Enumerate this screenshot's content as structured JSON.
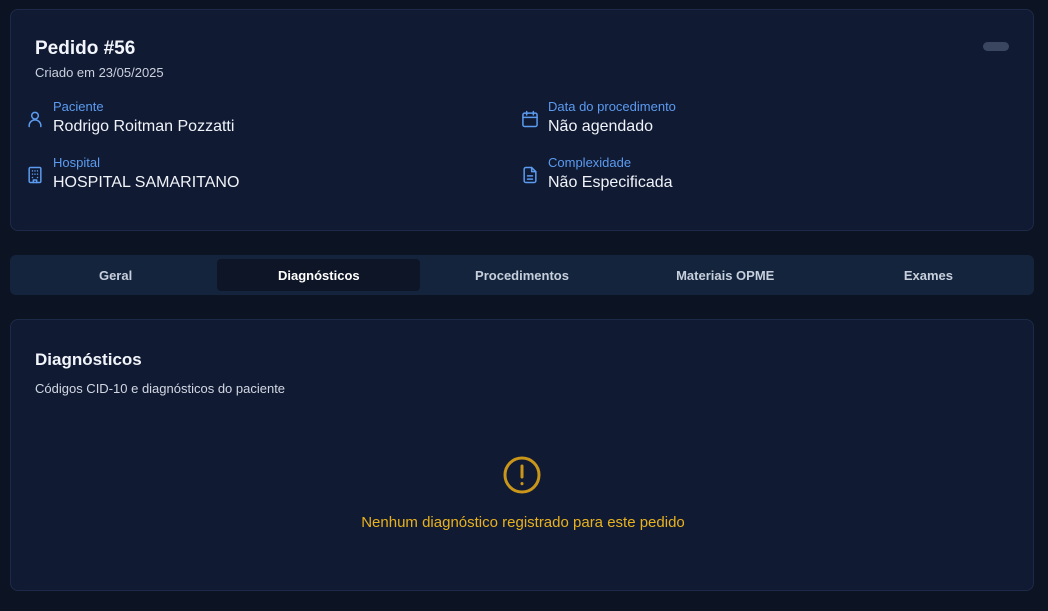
{
  "order": {
    "title": "Pedido #56",
    "created": "Criado em 23/05/2025"
  },
  "info": {
    "paciente": {
      "label": "Paciente",
      "value": "Rodrigo Roitman Pozzatti",
      "icon": "user-icon"
    },
    "data": {
      "label": "Data do procedimento",
      "value": "Não agendado",
      "icon": "calendar-icon"
    },
    "hospital": {
      "label": "Hospital",
      "value": "HOSPITAL SAMARITANO",
      "icon": "building-icon"
    },
    "complexidade": {
      "label": "Complexidade",
      "value": "Não Especificada",
      "icon": "file-text-icon"
    }
  },
  "tabs": [
    {
      "label": "Geral",
      "active": false
    },
    {
      "label": "Diagnósticos",
      "active": true
    },
    {
      "label": "Procedimentos",
      "active": false
    },
    {
      "label": "Materiais OPME",
      "active": false
    },
    {
      "label": "Exames",
      "active": false
    }
  ],
  "diagnosticos": {
    "title": "Diagnósticos",
    "subtitle": "Códigos CID-10 e diagnósticos do paciente",
    "empty_icon": "alert-circle-icon",
    "empty_message": "Nenhum diagnóstico registrado para este pedido"
  },
  "colors": {
    "background": "#0c1424",
    "card": "#111a33",
    "label_blue": "#5b9bf0",
    "warning": "#e8b21e"
  }
}
